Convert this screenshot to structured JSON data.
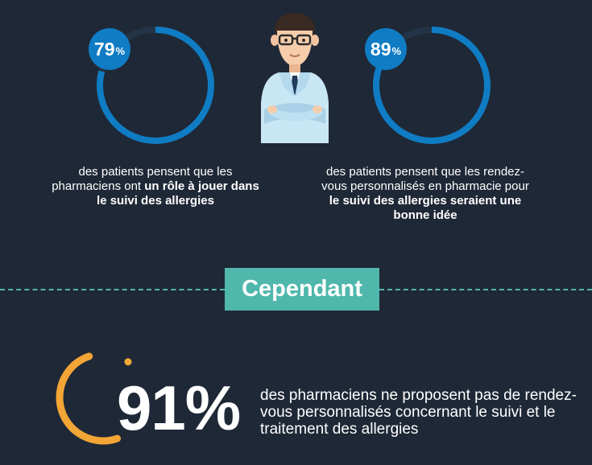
{
  "colors": {
    "background": "#1f2836",
    "accent_blue": "#0f7cc4",
    "ring_track": "#243447",
    "teal": "#50b7ac",
    "orange": "#f3a536"
  },
  "stat_left": {
    "value_num": "79",
    "value_pct": "%",
    "fraction": 0.79,
    "text_before": "des patients pensent que les pharmaciens ont ",
    "text_bold": "un rôle à jouer dans le suivi des allergies"
  },
  "stat_right": {
    "value_num": "89",
    "value_pct": "%",
    "fraction": 0.89,
    "text_before": "des patients pensent que les rendez-vous personnalisés en pharmacie pour ",
    "text_bold": "le suivi des allergies seraient une bonne idée"
  },
  "divider": {
    "label": "Cependant"
  },
  "stat_bottom": {
    "value": "91%",
    "fraction": 0.91,
    "text": "des pharmaciens ne proposent pas de rendez-vous personnalisés concernant le suivi et le traitement des allergies"
  },
  "illustration": {
    "icon": "pharmacist-icon"
  }
}
